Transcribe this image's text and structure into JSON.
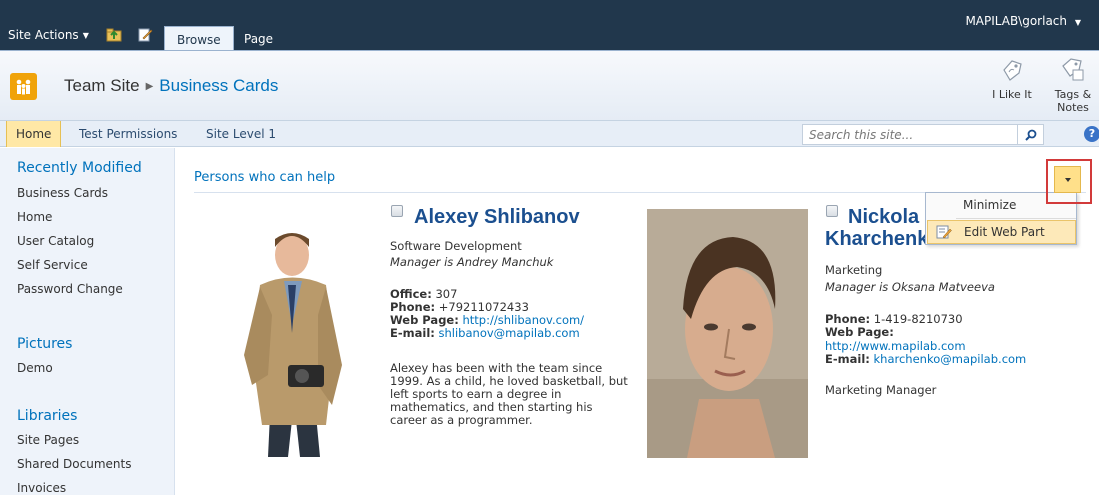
{
  "ribbon": {
    "site_actions": "Site Actions",
    "tabs": [
      "Browse",
      "Page"
    ],
    "user": "MAPILAB\\gorlach"
  },
  "header": {
    "site": "Team Site",
    "page": "Business Cards",
    "like_label": "I Like It",
    "tags_label_1": "Tags &",
    "tags_label_2": "Notes"
  },
  "topnav": {
    "items": [
      "Home",
      "Test Permissions",
      "Site Level 1"
    ],
    "search_placeholder": "Search this site..."
  },
  "quicklaunch": {
    "recent_heading": "Recently Modified",
    "recent_items": [
      "Business Cards",
      "Home",
      "User Catalog",
      "Self Service",
      "Password Change"
    ],
    "pictures_heading": "Pictures",
    "pictures_items": [
      "Demo"
    ],
    "libraries_heading": "Libraries",
    "libraries_items": [
      "Site Pages",
      "Shared Documents",
      "Invoices"
    ]
  },
  "webpart": {
    "title": "Persons who can help",
    "menu": [
      "Minimize",
      "Edit Web Part"
    ]
  },
  "cards": [
    {
      "name": "Alexey Shlibanov",
      "department": "Software Development",
      "manager": "Manager is Andrey Manchuk",
      "office_label": "Office:",
      "office": "307",
      "phone_label": "Phone:",
      "phone": "+79211072433",
      "web_label": "Web Page:",
      "web": "http://shlibanov.com/",
      "email_label": "E-mail:",
      "email": "shlibanov@mapilab.com",
      "bio": "Alexey has been with the team since 1999. As a child, he loved basketball, but left sports to earn a degree in mathematics, and then starting his career as a programmer."
    },
    {
      "name_line1": "Nickola",
      "name_line2": "Kharchenko",
      "department": "Marketing",
      "manager": "Manager is Oksana Matveeva",
      "phone_label": "Phone:",
      "phone": "1-419-8210730",
      "web_label": "Web Page:",
      "web": "http://www.mapilab.com",
      "email_label": "E-mail:",
      "email": "kharchenko@mapilab.com",
      "title": "Marketing Manager"
    }
  ],
  "colors": {
    "ribbon": "#21374c",
    "link": "#0072bc",
    "name": "#1b4f8f",
    "highlight": "#ffe8a6"
  }
}
